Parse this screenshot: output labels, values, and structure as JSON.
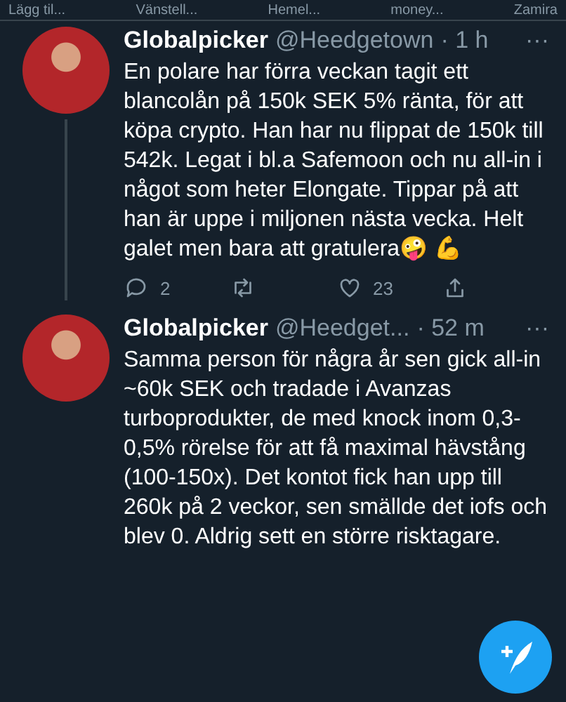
{
  "top_bar": {
    "items": [
      "Lägg til...",
      "Vänstell...",
      "Hemel...",
      "money...",
      "Zamira"
    ]
  },
  "tweets": [
    {
      "name": "Globalpicker",
      "handle": "@Heedgetown",
      "time": "· 1 h",
      "more": "···",
      "text": "En polare har förra veckan tagit ett blancolån på 150k SEK 5% ränta, för att köpa crypto. Han har nu flippat de 150k till 542k. Legat i bl.a Safemoon och nu all-in i något som heter Elongate. Tippar på att han är uppe i miljonen nästa vecka. Helt galet men bara att gratulera🤪 💪",
      "thread_below": true,
      "actions": {
        "replies": "2",
        "likes": "23"
      }
    },
    {
      "name": "Globalpicker",
      "handle": "@Heedget...",
      "time": "· 52 m",
      "more": "···",
      "text": "Samma person för några år sen gick all-in ~60k SEK och tradade i Avanzas turboprodukter, de med knock inom 0,3-0,5% rörelse för att få maximal hävstång (100-150x). Det kontot fick han upp till 260k på 2 veckor, sen smällde det iofs och blev 0. Aldrig sett en större risktagare.",
      "thread_below": false
    }
  ]
}
